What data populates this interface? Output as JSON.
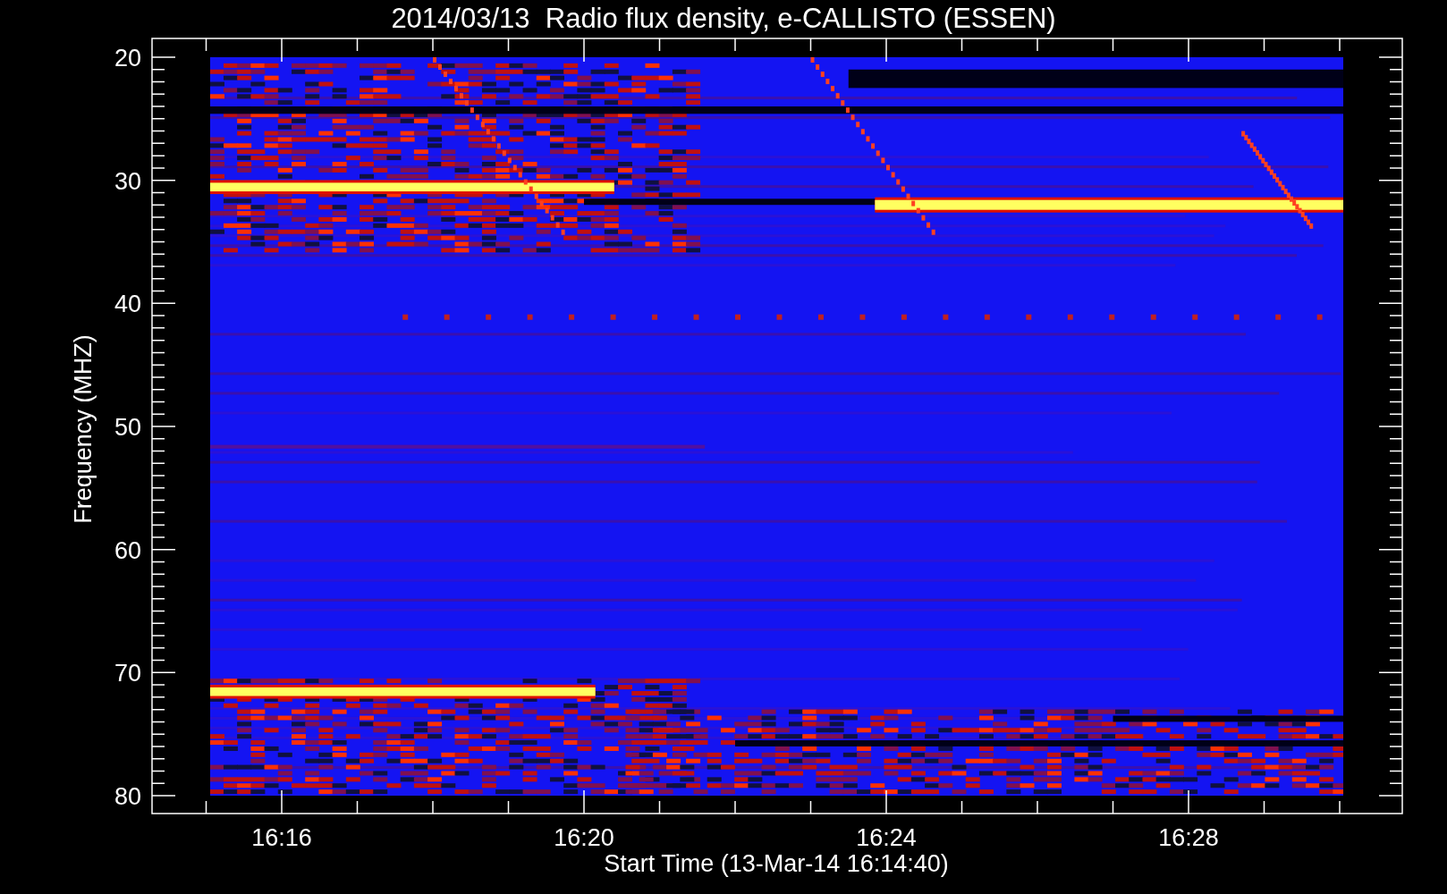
{
  "title": "2014/03/13  Radio flux density, e-CALLISTO (ESSEN)",
  "y_axis": {
    "label": "Frequency (MHZ)",
    "ticks": [
      "20",
      "30",
      "40",
      "50",
      "60",
      "70",
      "80"
    ]
  },
  "x_axis": {
    "label": "Start Time (13-Mar-14 16:14:40)",
    "ticks": [
      "16:16",
      "16:20",
      "16:24",
      "16:28"
    ]
  }
}
